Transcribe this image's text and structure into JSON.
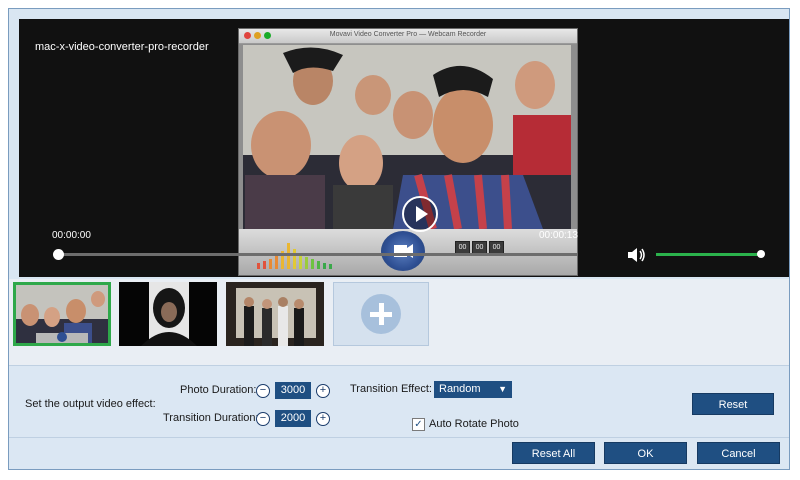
{
  "preview": {
    "title": "mac-x-video-converter-pro-recorder",
    "recorder_window_title": "Movavi Video Converter Pro — Webcam Recorder",
    "recorder_time": [
      "00",
      "00",
      "00"
    ],
    "current_time": "00:00:00",
    "total_time": "00:00:13",
    "seek_progress": 0.0,
    "volume_level": 1.0,
    "icons": {
      "play": "play-icon",
      "volume": "speaker-icon",
      "record": "camera-icon"
    }
  },
  "thumbnails": {
    "items": [
      {
        "name": "group-selfie",
        "selected": true
      },
      {
        "name": "hooded-person",
        "selected": false
      },
      {
        "name": "group-standing",
        "selected": false
      }
    ],
    "add_icon": "plus-icon"
  },
  "settings": {
    "output_label": "Set the output video effect:",
    "photo_duration_label": "Photo Duration:",
    "photo_duration_value": "3000",
    "transition_duration_label": "Transition Duration:",
    "transition_duration_value": "2000",
    "transition_effect_label": "Transition Effect:",
    "transition_effect_value": "Random",
    "auto_rotate_label": "Auto Rotate Photo",
    "auto_rotate_checked": true,
    "reset_label": "Reset"
  },
  "footer": {
    "reset_all_label": "Reset All",
    "ok_label": "OK",
    "cancel_label": "Cancel"
  },
  "colors": {
    "accent": "#1f4f82",
    "progress_green": "#2bb24c",
    "panel_bg": "#dbe7f3"
  }
}
